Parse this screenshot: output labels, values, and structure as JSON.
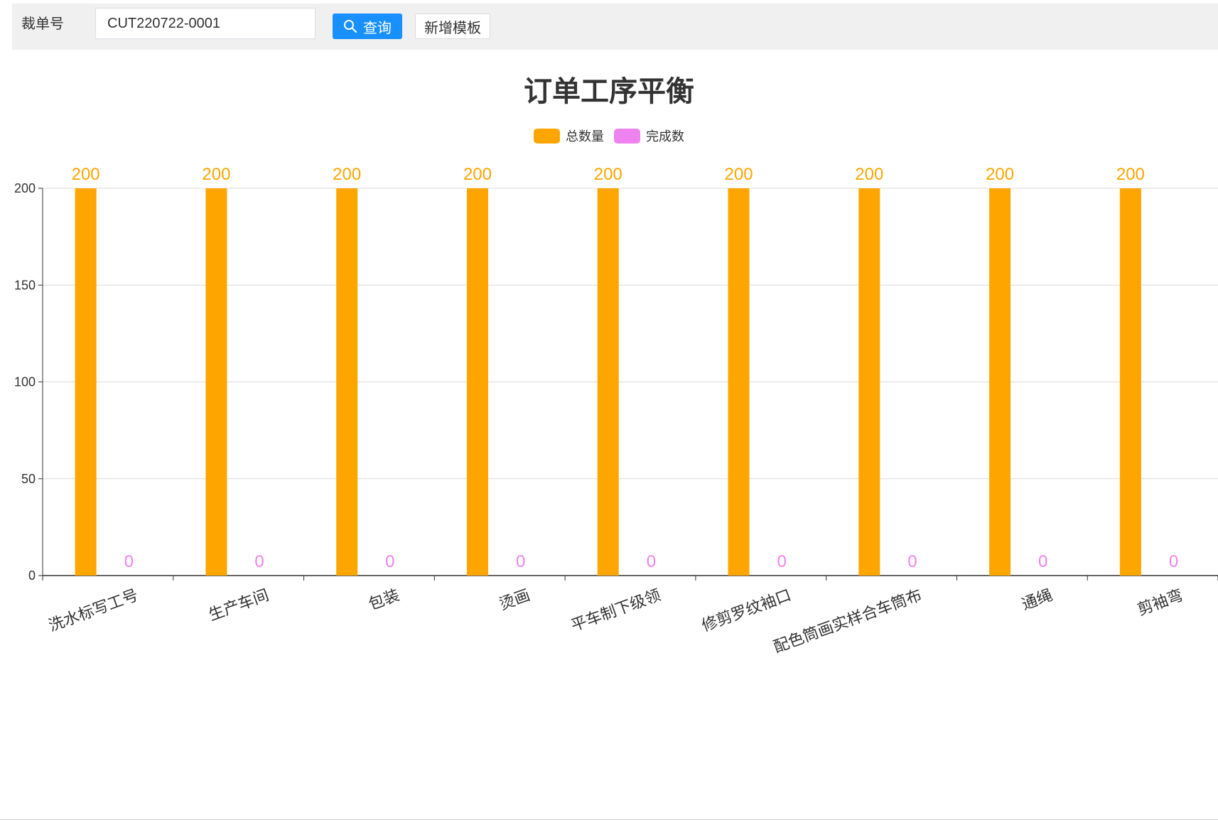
{
  "toolbar": {
    "label": "裁单号",
    "input_value": "CUT220722-0001",
    "search_button": "查询",
    "new_template_button": "新增模板"
  },
  "chart_data": {
    "type": "bar",
    "title": "订单工序平衡",
    "categories": [
      "洗水标写工号",
      "生产车间",
      "包装",
      "烫画",
      "平车制下级领",
      "修剪罗纹袖口",
      "配色筒画实样合车筒布",
      "通绳",
      "剪袖弯"
    ],
    "series": [
      {
        "name": "总数量",
        "values": [
          200,
          200,
          200,
          200,
          200,
          200,
          200,
          200,
          200
        ],
        "color": "#ffa500"
      },
      {
        "name": "完成数",
        "values": [
          0,
          0,
          0,
          0,
          0,
          0,
          0,
          0,
          0
        ],
        "color": "#ee82ee"
      }
    ],
    "ylim": [
      0,
      200
    ],
    "yticks": [
      0,
      50,
      100,
      150,
      200
    ],
    "grid": true,
    "legend_position": "top-center",
    "data_labels": true
  }
}
